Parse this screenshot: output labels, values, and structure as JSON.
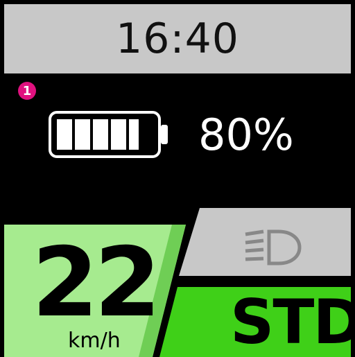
{
  "status": {
    "time": "16:40",
    "notification_count": "1"
  },
  "battery": {
    "percent_text": "80%",
    "level": 0.8
  },
  "speed": {
    "value": "22",
    "unit": "km/h"
  },
  "lights": {
    "icon": "headlight-icon"
  },
  "assist_mode": {
    "label": "STD"
  },
  "colors": {
    "top_bar": "#c8c8c8",
    "speed_panel": "#a6eb8f",
    "mode_panel": "#3fd018",
    "light_panel": "#c8c8c8",
    "badge": "#e0117f"
  }
}
